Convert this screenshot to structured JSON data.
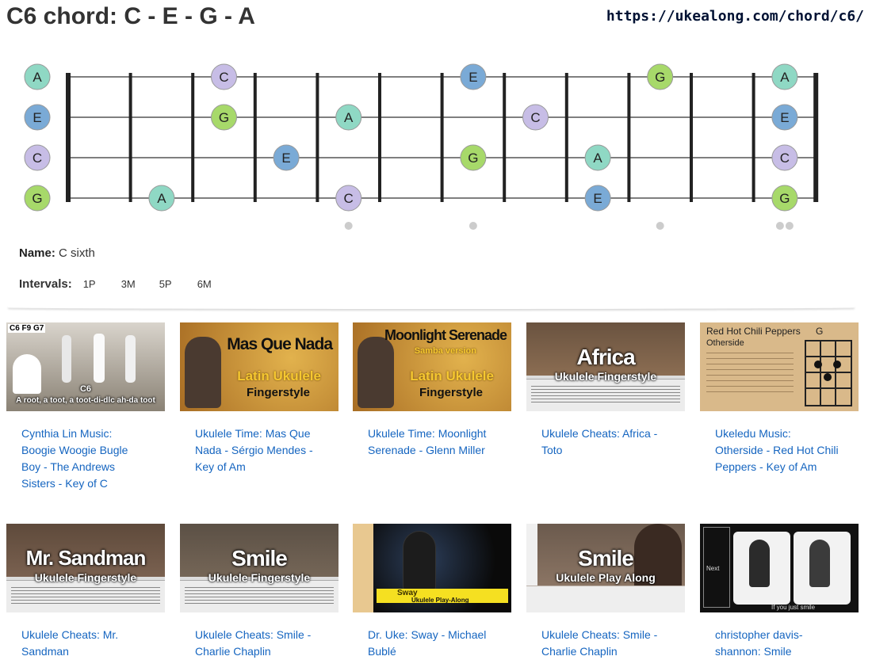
{
  "page": {
    "title": "C6 chord: C - E - G - A",
    "url": "https://ukealong.com/chord/c6/"
  },
  "colors": {
    "A": "#8fd8c4",
    "C": "#c7bde6",
    "E": "#7aaad6",
    "G": "#a7d96a"
  },
  "fretboard": {
    "fret_count": 12,
    "strings": [
      {
        "open": "A",
        "notes": [
          {
            "fret": 3,
            "note": "C"
          },
          {
            "fret": 7,
            "note": "E"
          },
          {
            "fret": 10,
            "note": "G"
          },
          {
            "fret": 12,
            "note": "A"
          }
        ]
      },
      {
        "open": "E",
        "notes": [
          {
            "fret": 3,
            "note": "G"
          },
          {
            "fret": 5,
            "note": "A"
          },
          {
            "fret": 8,
            "note": "C"
          },
          {
            "fret": 12,
            "note": "E"
          }
        ]
      },
      {
        "open": "C",
        "notes": [
          {
            "fret": 4,
            "note": "E"
          },
          {
            "fret": 7,
            "note": "G"
          },
          {
            "fret": 9,
            "note": "A"
          },
          {
            "fret": 12,
            "note": "C"
          }
        ]
      },
      {
        "open": "G",
        "notes": [
          {
            "fret": 2,
            "note": "A"
          },
          {
            "fret": 5,
            "note": "C"
          },
          {
            "fret": 9,
            "note": "E"
          },
          {
            "fret": 12,
            "note": "G"
          }
        ]
      }
    ],
    "inlay_frets": [
      5,
      7,
      10,
      12
    ]
  },
  "chord_info": {
    "name_label": "Name:",
    "name_value": "C sixth",
    "intervals_label": "Intervals:",
    "intervals": [
      "1P",
      "3M",
      "5P",
      "6M"
    ]
  },
  "videos": [
    {
      "caption": "Cynthia Lin Music: Boogie Woogie Bugle Boy - The Andrews Sisters - Key of C",
      "thumb_big": "C6",
      "thumb_small": "A root, a toot, a toot-di-dlc ah-da toot",
      "thumb_top": "C6  F9  G7",
      "bg": "#8a8275"
    },
    {
      "caption": "Ukulele Time: Mas Que Nada - Sérgio Mendes - Key of Am",
      "thumb_big": "Mas Que Nada",
      "thumb_mid": "Latin Ukulele",
      "thumb_small": "Fingerstyle",
      "bg": "#b8863c"
    },
    {
      "caption": "Ukulele Time: Moonlight Serenade - Glenn Miller",
      "thumb_big": "Moonlight Serenade",
      "thumb_top": "Samba version",
      "thumb_mid": "Latin Ukulele",
      "thumb_small": "Fingerstyle",
      "bg": "#b8863c"
    },
    {
      "caption": "Ukulele Cheats: Africa - Toto",
      "thumb_big": "Africa",
      "thumb_small": "Ukulele Fingerstyle",
      "bg": "#6a5340"
    },
    {
      "caption": "Ukeledu Music: Otherside - Red Hot Chili Peppers - Key of Am",
      "thumb_big": "Red Hot Chili Peppers",
      "thumb_top": "Otherside",
      "thumb_chord": "G",
      "bg": "#d9b98a"
    },
    {
      "caption": "Ukulele Cheats: Mr. Sandman",
      "thumb_big": "Mr. Sandman",
      "thumb_small": "Ukulele Fingerstyle",
      "bg": "#5e4a3b"
    },
    {
      "caption": "Ukulele Cheats: Smile - Charlie Chaplin",
      "thumb_big": "Smile",
      "thumb_small": "Ukulele Fingerstyle",
      "bg": "#5b5045"
    },
    {
      "caption": "Dr. Uke: Sway - Michael Bublé",
      "thumb_big": "Sway",
      "thumb_small": "Ukulele Play-Along",
      "bg": "#141414"
    },
    {
      "caption": "Ukulele Cheats: Smile - Charlie Chaplin",
      "thumb_big": "Smile",
      "thumb_small": "Ukulele Play Along",
      "bg": "#6b5a4d"
    },
    {
      "caption": "christopher davis-shannon: Smile",
      "thumb_top": "Next",
      "thumb_small": "If you just smile",
      "bg": "#1a1a1a"
    }
  ]
}
